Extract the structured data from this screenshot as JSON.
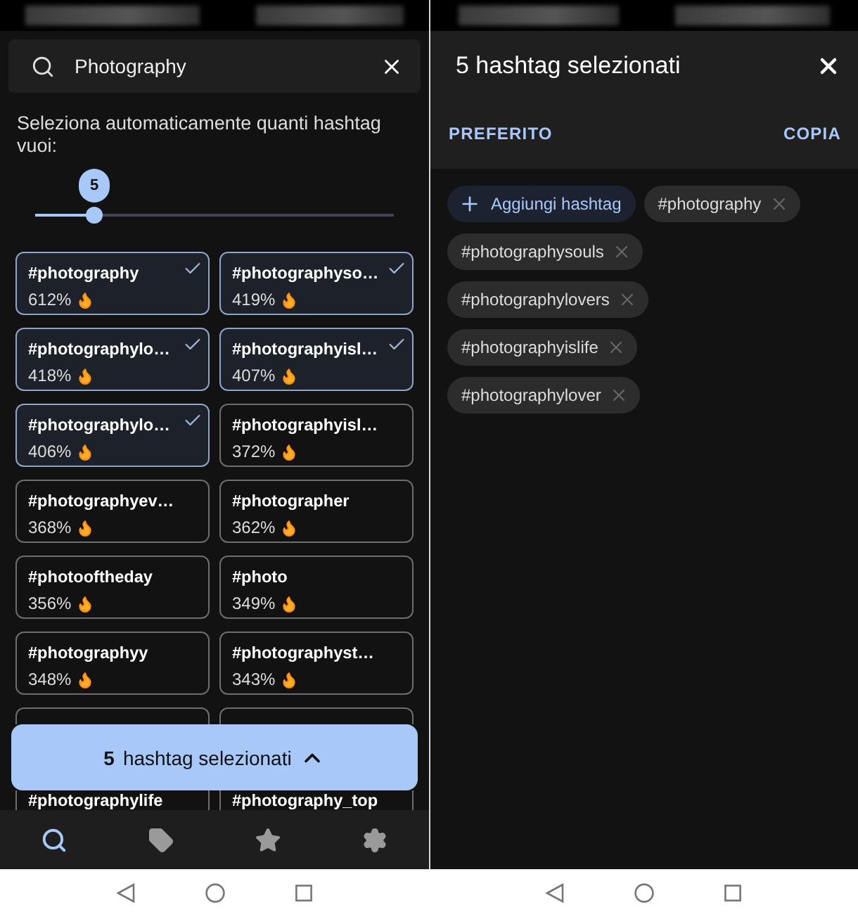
{
  "left": {
    "search": {
      "value": "Photography"
    },
    "prompt": "Seleziona automaticamente quanti hashtag vuoi:",
    "slider": {
      "value": "5",
      "level": 0.165
    },
    "cards": [
      {
        "kind": "full",
        "name": "#photography",
        "reading": "612%",
        "selected": true
      },
      {
        "kind": "full",
        "name": "#photographyso…",
        "reading": "419%",
        "selected": true
      },
      {
        "kind": "full",
        "name": "#photographylo…",
        "reading": "418%",
        "selected": true
      },
      {
        "kind": "full",
        "name": "#photographyisl…",
        "reading": "407%",
        "selected": true
      },
      {
        "kind": "full",
        "name": "#photographylo…",
        "reading": "406%",
        "selected": true
      },
      {
        "kind": "full",
        "name": "#photographyisl…",
        "reading": "372%",
        "selected": false
      },
      {
        "kind": "full",
        "name": "#photographyev…",
        "reading": "368%",
        "selected": false
      },
      {
        "kind": "full",
        "name": "#photographer",
        "reading": "362%",
        "selected": false
      },
      {
        "kind": "full",
        "name": "#photooftheday",
        "reading": "356%",
        "selected": false
      },
      {
        "kind": "full",
        "name": "#photo",
        "reading": "349%",
        "selected": false
      },
      {
        "kind": "full",
        "name": "#photographyy",
        "reading": "348%",
        "selected": false
      },
      {
        "kind": "full",
        "name": "#photographyst…",
        "reading": "343%",
        "selected": false
      },
      {
        "kind": "top_edge",
        "selected": false
      },
      {
        "kind": "top_edge",
        "selected": false
      },
      {
        "kind": "bottom_edge",
        "name": "#photographylife",
        "selected": false
      },
      {
        "kind": "bottom_edge",
        "name": "#photography_top",
        "selected": false
      }
    ],
    "selection_bar": {
      "count": "5",
      "label": "hashtag selezionati"
    },
    "nav": [
      {
        "kind": "search",
        "selected": true
      },
      {
        "kind": "tags",
        "selected": false
      },
      {
        "kind": "star",
        "selected": false
      },
      {
        "kind": "settings",
        "selected": false
      }
    ]
  },
  "right": {
    "title": "5 hashtag selezionati",
    "actions": [
      "PREFERITO",
      "COPIA"
    ],
    "add_chip": "Aggiungi hashtag",
    "chips": [
      "#photography",
      "#photographysouls",
      "#photographylovers",
      "#photographyislife",
      "#photographylover"
    ]
  }
}
